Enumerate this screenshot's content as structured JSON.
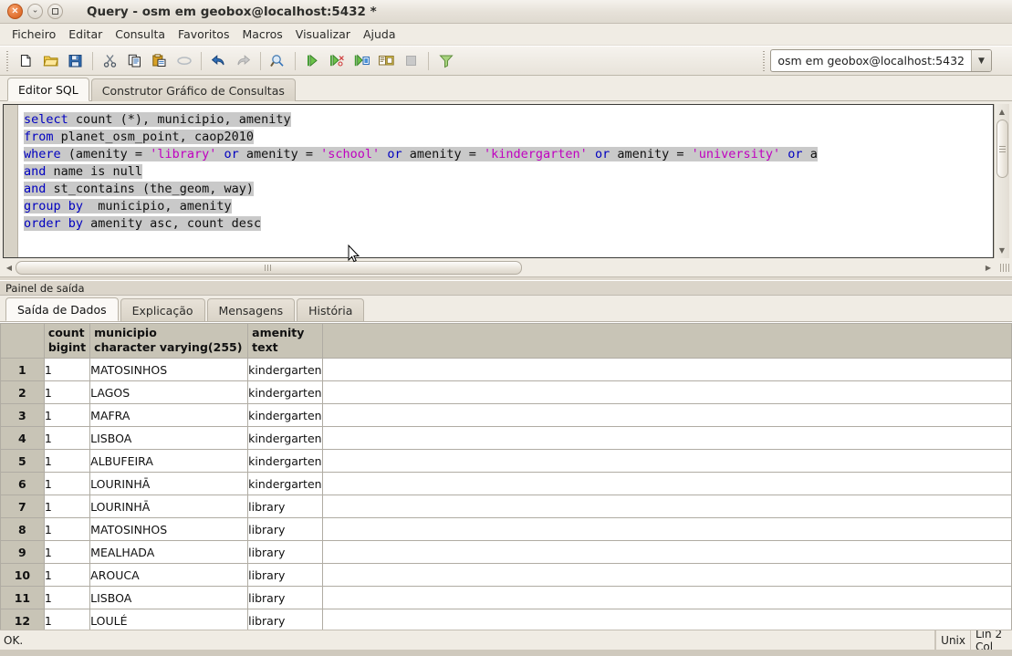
{
  "window": {
    "title": "Query - osm em geobox@localhost:5432 *",
    "buttons": {
      "close": "×",
      "minimize": "⌄",
      "maximize": "□"
    }
  },
  "menu": {
    "items": [
      {
        "label": "Ficheiro",
        "name": "menu-ficheiro"
      },
      {
        "label": "Editar",
        "name": "menu-editar"
      },
      {
        "label": "Consulta",
        "name": "menu-consulta"
      },
      {
        "label": "Favoritos",
        "name": "menu-favoritos"
      },
      {
        "label": "Macros",
        "name": "menu-macros"
      },
      {
        "label": "Visualizar",
        "name": "menu-visualizar"
      },
      {
        "label": "Ajuda",
        "name": "menu-ajuda"
      }
    ]
  },
  "toolbar": {
    "icons": [
      "new-file-icon",
      "open-folder-icon",
      "save-icon",
      "cut-icon",
      "copy-icon",
      "paste-icon",
      "clear-icon",
      "undo-icon",
      "redo-icon",
      "find-replace-icon",
      "execute-query-icon",
      "execute-to-file-icon",
      "explain-query-icon",
      "explain-analyze-icon",
      "stop-icon",
      "filter-icon"
    ],
    "connection": {
      "value": "osm em geobox@localhost:5432",
      "arrow": "▼"
    }
  },
  "editor_tabs": [
    {
      "label": "Editor SQL",
      "active": true
    },
    {
      "label": "Construtor Gráfico de Consultas",
      "active": false
    }
  ],
  "sql": {
    "lines": [
      [
        {
          "t": "select",
          "c": "kw"
        },
        {
          "t": " count (*), municipio, amenity",
          "c": "plain"
        }
      ],
      [
        {
          "t": "from",
          "c": "kw"
        },
        {
          "t": " planet_osm_point, caop2010",
          "c": "plain"
        }
      ],
      [
        {
          "t": "where",
          "c": "kw"
        },
        {
          "t": " (amenity = ",
          "c": "plain"
        },
        {
          "t": "'library'",
          "c": "str"
        },
        {
          "t": " ",
          "c": "plain"
        },
        {
          "t": "or",
          "c": "kw"
        },
        {
          "t": " amenity = ",
          "c": "plain"
        },
        {
          "t": "'school'",
          "c": "str"
        },
        {
          "t": " ",
          "c": "plain"
        },
        {
          "t": "or",
          "c": "kw"
        },
        {
          "t": " amenity = ",
          "c": "plain"
        },
        {
          "t": "'kindergarten'",
          "c": "str"
        },
        {
          "t": " ",
          "c": "plain"
        },
        {
          "t": "or",
          "c": "kw"
        },
        {
          "t": " amenity = ",
          "c": "plain"
        },
        {
          "t": "'university'",
          "c": "str"
        },
        {
          "t": " ",
          "c": "plain"
        },
        {
          "t": "or",
          "c": "kw"
        },
        {
          "t": " a",
          "c": "plain"
        }
      ],
      [
        {
          "t": "and",
          "c": "kw"
        },
        {
          "t": " name is null",
          "c": "plain"
        }
      ],
      [
        {
          "t": "and",
          "c": "kw"
        },
        {
          "t": " st_contains (the_geom, way)",
          "c": "plain"
        }
      ],
      [
        {
          "t": "group by",
          "c": "kw"
        },
        {
          "t": "  municipio, amenity",
          "c": "plain"
        }
      ],
      [
        {
          "t": "order by",
          "c": "kw"
        },
        {
          "t": " amenity asc, count desc",
          "c": "plain"
        }
      ]
    ]
  },
  "output_panel": {
    "label": "Painel de saída",
    "tabs": [
      {
        "label": "Saída de Dados",
        "active": true
      },
      {
        "label": "Explicação",
        "active": false
      },
      {
        "label": "Mensagens",
        "active": false
      },
      {
        "label": "História",
        "active": false
      }
    ]
  },
  "grid": {
    "columns": [
      {
        "name": "count",
        "type": "bigint"
      },
      {
        "name": "municipio",
        "type": "character varying(255)"
      },
      {
        "name": "amenity",
        "type": "text"
      }
    ],
    "rows": [
      {
        "n": "1",
        "count": "1",
        "municipio": "MATOSINHOS",
        "amenity": "kindergarten"
      },
      {
        "n": "2",
        "count": "1",
        "municipio": "LAGOS",
        "amenity": "kindergarten"
      },
      {
        "n": "3",
        "count": "1",
        "municipio": "MAFRA",
        "amenity": "kindergarten"
      },
      {
        "n": "4",
        "count": "1",
        "municipio": "LISBOA",
        "amenity": "kindergarten"
      },
      {
        "n": "5",
        "count": "1",
        "municipio": "ALBUFEIRA",
        "amenity": "kindergarten"
      },
      {
        "n": "6",
        "count": "1",
        "municipio": "LOURINHĀ",
        "amenity": "kindergarten"
      },
      {
        "n": "7",
        "count": "1",
        "municipio": "LOURINHĀ",
        "amenity": "library"
      },
      {
        "n": "8",
        "count": "1",
        "municipio": "MATOSINHOS",
        "amenity": "library"
      },
      {
        "n": "9",
        "count": "1",
        "municipio": "MEALHADA",
        "amenity": "library"
      },
      {
        "n": "10",
        "count": "1",
        "municipio": "AROUCA",
        "amenity": "library"
      },
      {
        "n": "11",
        "count": "1",
        "municipio": "LISBOA",
        "amenity": "library"
      },
      {
        "n": "12",
        "count": "1",
        "municipio": "LOULÉ",
        "amenity": "library"
      }
    ]
  },
  "statusbar": {
    "message": "OK.",
    "eol": "Unix",
    "position": "Lin 2 Col"
  },
  "colors": {
    "keyword": "#0000c0",
    "string": "#c000c0",
    "selection": "#c9c9c9",
    "header_bg": "#c8c4b6",
    "chrome": "#f0ece4"
  }
}
